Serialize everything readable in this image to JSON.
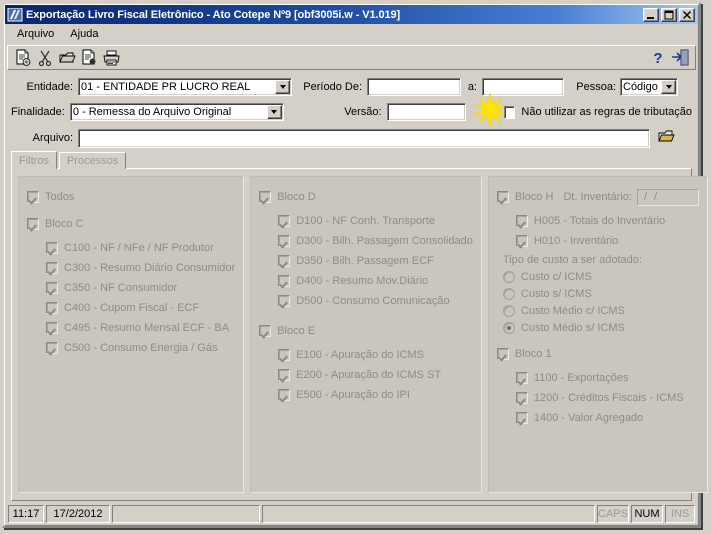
{
  "window": {
    "title": "Exportação Livro Fiscal Eletrônico - Ato Cotepe Nº9 [obf3005i.w - V1.019]",
    "minimize_label": "_",
    "maximize_label": "□",
    "close_label": "×"
  },
  "menu": {
    "items": [
      {
        "label": "Arquivo"
      },
      {
        "label": "Ajuda"
      }
    ]
  },
  "toolbar": {
    "left_icons": [
      {
        "name": "process-document-icon",
        "glyph": "▤"
      },
      {
        "name": "cut-scissors-icon",
        "glyph": "✂"
      },
      {
        "name": "open-folder-icon",
        "glyph": "▣"
      },
      {
        "name": "document-properties-icon",
        "glyph": "▥"
      },
      {
        "name": "printer-icon",
        "glyph": "⎙"
      }
    ],
    "right_icons": [
      {
        "name": "help-icon",
        "glyph": "?"
      },
      {
        "name": "exit-door-icon",
        "glyph": "⎆"
      }
    ]
  },
  "form": {
    "entidade_label": "Entidade:",
    "entidade_value": "01 - ENTIDADE PR LUCRO REAL",
    "periodo_de_label": "Período De:",
    "periodo_de_value": "",
    "periodo_a_label": "a:",
    "periodo_a_value": "",
    "pessoa_label": "Pessoa:",
    "pessoa_value": "Código",
    "finalidade_label": "Finalidade:",
    "finalidade_value": "0 - Remessa do Arquivo Original",
    "versao_label": "Versão:",
    "versao_value": "",
    "nao_utilizar_label": "Não utilizar as regras de tributação",
    "nao_utilizar_checked": false,
    "arquivo_label": "Arquivo:",
    "arquivo_value": "",
    "browse_icon": "open-file-icon"
  },
  "tabs": [
    {
      "label": "Filtros",
      "active": true
    },
    {
      "label": "Processos",
      "active": false
    }
  ],
  "panels": {
    "left": {
      "todos": {
        "label": "Todos",
        "checked": true
      },
      "bloco_c": {
        "label": "Bloco C",
        "checked": true
      },
      "bloco_c_items": [
        {
          "label": "C100 - NF / NFe / NF Produtor",
          "checked": true
        },
        {
          "label": "C300 - Resumo Diário Consumidor",
          "checked": true
        },
        {
          "label": "C350 - NF Consumidor",
          "checked": true
        },
        {
          "label": "C400 - Cupom Fiscal - ECF",
          "checked": true
        },
        {
          "label": "C495 - Resumo Mensal ECF - BA",
          "checked": true
        },
        {
          "label": "C500 - Consumo Energia / Gás",
          "checked": true
        }
      ]
    },
    "middle": {
      "bloco_d": {
        "label": "Bloco D",
        "checked": true
      },
      "bloco_d_items": [
        {
          "label": "D100 - NF Conh. Transporte",
          "checked": true
        },
        {
          "label": "D300 - Bilh. Passagem Consolidado",
          "checked": true
        },
        {
          "label": "D350 - Bilh. Passagem ECF",
          "checked": true
        },
        {
          "label": "D400 - Resumo Mov.Diário",
          "checked": true
        },
        {
          "label": "D500 - Consumo Comunicação",
          "checked": true
        }
      ],
      "bloco_e": {
        "label": "Bloco E",
        "checked": true
      },
      "bloco_e_items": [
        {
          "label": "E100 - Apuração do ICMS",
          "checked": true
        },
        {
          "label": "E200 - Apuração do ICMS ST",
          "checked": true
        },
        {
          "label": "E500 - Apuração do IPI",
          "checked": true
        }
      ]
    },
    "right": {
      "bloco_h": {
        "label": "Bloco H",
        "checked": true
      },
      "dt_inventario_label": "Dt. Inventário:",
      "dt_inventario_value": "/  /",
      "bloco_h_items": [
        {
          "label": "H005 - Totais do Inventário",
          "checked": true
        },
        {
          "label": "H010 - Inventário",
          "checked": true
        }
      ],
      "tipo_custo_label": "Tipo de custo a ser adotado:",
      "tipo_custo_options": [
        {
          "label": "Custo c/ ICMS",
          "selected": false
        },
        {
          "label": "Custo s/ ICMS",
          "selected": false
        },
        {
          "label": "Custo Médio c/ ICMS",
          "selected": false
        },
        {
          "label": "Custo Médio s/ ICMS",
          "selected": true
        }
      ],
      "bloco_1": {
        "label": "Bloco 1",
        "checked": true
      },
      "bloco_1_items": [
        {
          "label": "1100 - Exportações",
          "checked": true
        },
        {
          "label": "1200 - Créditos Fiscais - ICMS",
          "checked": true
        },
        {
          "label": "1400 - Valor Agregado",
          "checked": true
        }
      ]
    }
  },
  "statusbar": {
    "time": "11:17",
    "date": "17/2/2012",
    "message1": "",
    "message2": "",
    "caps": "CAPS",
    "num": "NUM",
    "ins": "INS",
    "caps_active": false,
    "num_active": true,
    "ins_active": false
  },
  "colors": {
    "title_start": "#0a246a",
    "title_end": "#a6c8f0",
    "face": "#d4d0c8",
    "panel": "#cac6be",
    "disabled_text": "#8f8c86",
    "highlight_star": "#ffe400"
  }
}
